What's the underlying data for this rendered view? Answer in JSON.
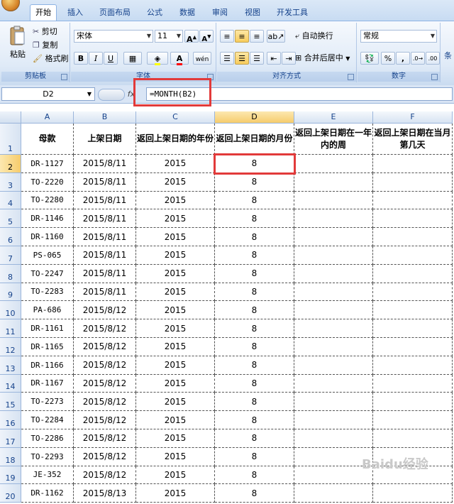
{
  "tabs": [
    "开始",
    "插入",
    "页面布局",
    "公式",
    "数据",
    "审阅",
    "视图",
    "开发工具"
  ],
  "clipboard": {
    "paste": "粘贴",
    "cut": "剪切",
    "copy": "复制",
    "format_painter": "格式刷",
    "label": "剪贴板"
  },
  "font": {
    "name": "宋体",
    "size": "11",
    "bold": "B",
    "italic": "I",
    "underline": "U",
    "label": "字体",
    "text_color": "#ff0000",
    "fill_color": "#ffff00"
  },
  "alignment": {
    "wrap": "自动换行",
    "merge": "合并后居中",
    "label": "对齐方式"
  },
  "number": {
    "format": "常规",
    "percent": "%",
    "comma": ",",
    "label": "数字"
  },
  "clipped_label": "条",
  "formula_bar": {
    "name_box": "D2",
    "fx": "fx",
    "formula": "=MONTH(B2)"
  },
  "columns": [
    "A",
    "B",
    "C",
    "D",
    "E",
    "F"
  ],
  "header_row": {
    "num": "1",
    "cells": [
      "母款",
      "上架日期",
      "返回上架日期的年份",
      "返回上架日期的月份",
      "返回上架日期在一年内的周",
      "返回上架日期在当月第几天"
    ]
  },
  "rows": [
    {
      "num": "2",
      "code": "DR-1127",
      "date": "2015/8/11",
      "year": "2015",
      "month": "8"
    },
    {
      "num": "3",
      "code": "TO-2220",
      "date": "2015/8/11",
      "year": "2015",
      "month": "8"
    },
    {
      "num": "4",
      "code": "TO-2280",
      "date": "2015/8/11",
      "year": "2015",
      "month": "8"
    },
    {
      "num": "5",
      "code": "DR-1146",
      "date": "2015/8/11",
      "year": "2015",
      "month": "8"
    },
    {
      "num": "6",
      "code": "DR-1160",
      "date": "2015/8/11",
      "year": "2015",
      "month": "8"
    },
    {
      "num": "7",
      "code": "PS-065",
      "date": "2015/8/11",
      "year": "2015",
      "month": "8"
    },
    {
      "num": "8",
      "code": "TO-2247",
      "date": "2015/8/11",
      "year": "2015",
      "month": "8"
    },
    {
      "num": "9",
      "code": "TO-2283",
      "date": "2015/8/11",
      "year": "2015",
      "month": "8"
    },
    {
      "num": "10",
      "code": "PA-686",
      "date": "2015/8/12",
      "year": "2015",
      "month": "8"
    },
    {
      "num": "11",
      "code": "DR-1161",
      "date": "2015/8/12",
      "year": "2015",
      "month": "8"
    },
    {
      "num": "12",
      "code": "DR-1165",
      "date": "2015/8/12",
      "year": "2015",
      "month": "8"
    },
    {
      "num": "13",
      "code": "DR-1166",
      "date": "2015/8/12",
      "year": "2015",
      "month": "8"
    },
    {
      "num": "14",
      "code": "DR-1167",
      "date": "2015/8/12",
      "year": "2015",
      "month": "8"
    },
    {
      "num": "15",
      "code": "TO-2273",
      "date": "2015/8/12",
      "year": "2015",
      "month": "8"
    },
    {
      "num": "16",
      "code": "TO-2284",
      "date": "2015/8/12",
      "year": "2015",
      "month": "8"
    },
    {
      "num": "17",
      "code": "TO-2286",
      "date": "2015/8/12",
      "year": "2015",
      "month": "8"
    },
    {
      "num": "18",
      "code": "TO-2293",
      "date": "2015/8/12",
      "year": "2015",
      "month": "8"
    },
    {
      "num": "19",
      "code": "JE-352",
      "date": "2015/8/12",
      "year": "2015",
      "month": "8"
    },
    {
      "num": "20",
      "code": "DR-1162",
      "date": "2015/8/13",
      "year": "2015",
      "month": "8"
    }
  ],
  "watermark": "Baidu经验",
  "highlight_color": "#e23a3a"
}
